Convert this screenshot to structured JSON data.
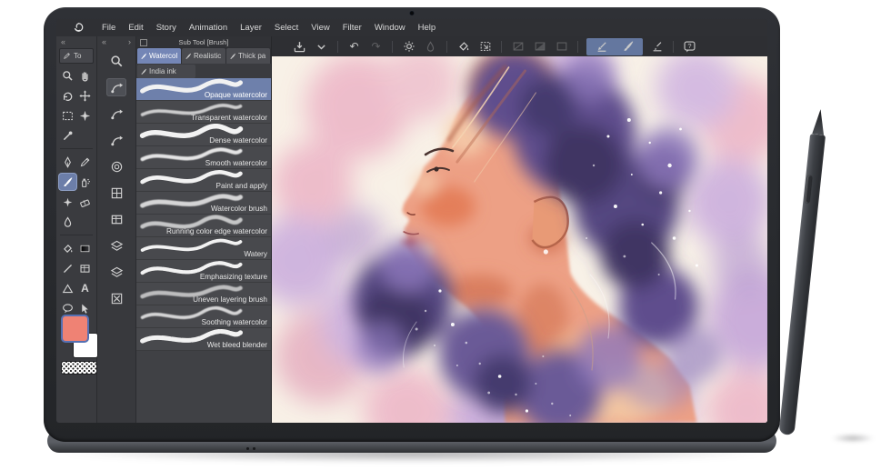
{
  "menubar": {
    "logo_name": "clip-studio-paint-logo",
    "items": [
      "File",
      "Edit",
      "Story",
      "Animation",
      "Layer",
      "Select",
      "View",
      "Filter",
      "Window",
      "Help"
    ]
  },
  "panels": {
    "tool_palette": {
      "collapse_glyph": "«",
      "header_label": "To",
      "text_tool_glyph": "A",
      "selected_tool": "brush-tool",
      "foreground_color": "#EF8274",
      "background_color": "#FFFFFF"
    },
    "quick_access": {
      "collapse_glyph": "«",
      "expand_glyph": "›"
    },
    "subtool": {
      "title": "Sub Tool [Brush]",
      "tabs": [
        "Watercol",
        "Realistic",
        "Thick pa"
      ],
      "selected_tab": "Watercol",
      "secondary_tab": "India ink",
      "brushes": [
        "Opaque watercolor",
        "Transparent watercolor",
        "Dense watercolor",
        "Smooth watercolor",
        "Paint and apply",
        "Watercolor brush",
        "Running color edge watercolor",
        "Watery",
        "Emphasizing texture",
        "Uneven layering brush",
        "Soothing watercolor",
        "Wet bleed blender"
      ],
      "selected_brush": "Opaque watercolor"
    }
  },
  "command_bar": {
    "undo_glyph": "↶",
    "redo_glyph": "↷",
    "help_glyph": "?",
    "active_icon_bg": "#64779F"
  },
  "canvas": {
    "paper_color": "#F7F0E6",
    "art_palette": {
      "hair_indigo": "#3F3463",
      "hair_violet": "#8D78BB",
      "lilac": "#C9ABDD",
      "pink": "#ECB4C6",
      "skin": "#EDA085",
      "skin_shadow": "#CF6D4C",
      "highlight": "#F6CFAE"
    }
  },
  "ui_colors": {
    "menubar_bg": "#2F3034",
    "panel_bg": "#3A3B3F",
    "selection_blue": "#6E80AB"
  }
}
